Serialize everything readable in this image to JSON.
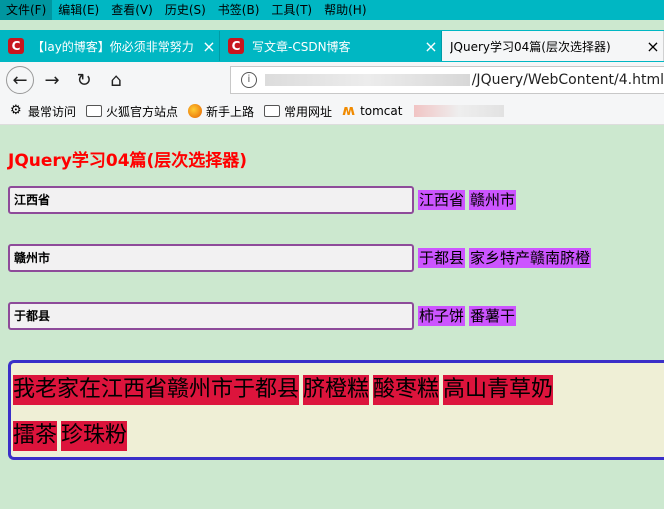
{
  "menu": [
    {
      "label": "文件(F)",
      "active": true
    },
    {
      "label": "编辑(E)"
    },
    {
      "label": "查看(V)"
    },
    {
      "label": "历史(S)"
    },
    {
      "label": "书签(B)"
    },
    {
      "label": "工具(T)"
    },
    {
      "label": "帮助(H)"
    }
  ],
  "tabs": [
    {
      "title": "【lay的博客】你必须非常努力",
      "logo": "C"
    },
    {
      "title": "写文章-CSDN博客",
      "logo": "C"
    },
    {
      "title": "JQuery学习04篇(层次选择器)"
    }
  ],
  "nav": {
    "back": "←",
    "forward": "→",
    "reload": "↻",
    "home": "⌂",
    "url": "/JQuery/WebContent/4.html"
  },
  "bookmarks": [
    {
      "label": "最常访问",
      "icon": "gear-icon"
    },
    {
      "label": "火狐官方站点",
      "icon": "folder-icon"
    },
    {
      "label": "新手上路",
      "icon": "firefox-icon"
    },
    {
      "label": "常用网址",
      "icon": "folder-icon"
    },
    {
      "label": "tomcat",
      "icon": "tomcat-icon"
    }
  ],
  "page": {
    "title": "JQuery学习04篇(层次选择器)",
    "rows": [
      {
        "value": "江西省",
        "tags": [
          "江西省",
          "赣州市"
        ]
      },
      {
        "value": "赣州市",
        "tags": [
          "于都县",
          "家乡特产赣南脐橙"
        ]
      },
      {
        "value": "于都县",
        "tags": [
          "柿子饼",
          "番薯干"
        ]
      }
    ],
    "panel": {
      "line1": [
        "我老家在江西省赣州市于都县",
        "脐橙糕",
        "酸枣糕",
        "高山青草奶"
      ],
      "line2": [
        "擂茶",
        "珍珠粉"
      ]
    }
  },
  "colors": {
    "chrome": "#00b7c3",
    "page_bg": "#cce8cf",
    "title": "#ff0000",
    "tag_bg": "#cc55ff",
    "panel_seg_bg": "#dc143c",
    "panel_border": "#3a2fc8"
  }
}
